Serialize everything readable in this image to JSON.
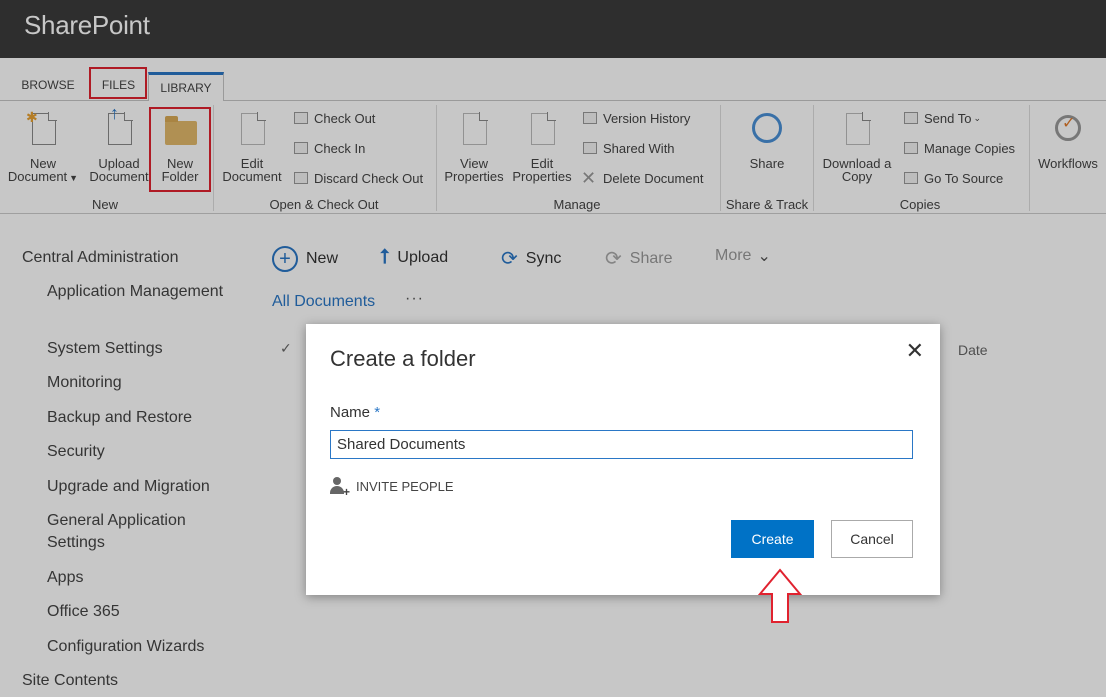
{
  "app": {
    "title": "SharePoint"
  },
  "ribbon_tabs": [
    {
      "label": "BROWSE"
    },
    {
      "label": "FILES"
    },
    {
      "label": "LIBRARY"
    }
  ],
  "ribbon": {
    "new_group": {
      "label": "New",
      "new_document": [
        "New",
        "Document"
      ],
      "upload_document": [
        "Upload",
        "Document"
      ],
      "new_folder": [
        "New",
        "Folder"
      ]
    },
    "open_checkout_group": {
      "label": "Open & Check Out",
      "edit_document": [
        "Edit",
        "Document"
      ],
      "check_out": "Check Out",
      "check_in": "Check In",
      "discard_check_out": "Discard Check Out"
    },
    "manage_group": {
      "label": "Manage",
      "view_properties": [
        "View",
        "Properties"
      ],
      "edit_properties": [
        "Edit",
        "Properties"
      ],
      "version_history": "Version History",
      "shared_with": "Shared With",
      "delete_document": "Delete Document"
    },
    "share_track_group": {
      "label": "Share & Track",
      "share": "Share"
    },
    "copies_group": {
      "label": "Copies",
      "download_copy": [
        "Download a",
        "Copy"
      ],
      "send_to": "Send To",
      "manage_copies": "Manage Copies",
      "go_to_source": "Go To Source"
    },
    "workflows": "Workflows"
  },
  "nav": {
    "items": [
      {
        "label": "Central Administration",
        "level": "top"
      },
      {
        "label": "Application Management",
        "level": "sub"
      },
      {
        "label": "System Settings",
        "level": "sub"
      },
      {
        "label": "Monitoring",
        "level": "sub"
      },
      {
        "label": "Backup and Restore",
        "level": "sub"
      },
      {
        "label": "Security",
        "level": "sub"
      },
      {
        "label": "Upgrade and Migration",
        "level": "sub"
      },
      {
        "label": "General Application Settings",
        "level": "sub"
      },
      {
        "label": "Apps",
        "level": "sub"
      },
      {
        "label": "Office 365",
        "level": "sub"
      },
      {
        "label": "Configuration Wizards",
        "level": "sub"
      },
      {
        "label": "Site Contents",
        "level": "top"
      }
    ]
  },
  "commandbar": {
    "new": "New",
    "upload": "Upload",
    "sync": "Sync",
    "share": "Share",
    "more": "More"
  },
  "view": {
    "all_documents": "All Documents",
    "ellipsis": "···",
    "date_column": "Date"
  },
  "dialog": {
    "title": "Create a folder",
    "name_label": "Name",
    "required_marker": "*",
    "name_value": "Shared Documents",
    "invite_people": "INVITE PEOPLE",
    "create": "Create",
    "cancel": "Cancel",
    "close_symbol": "✕"
  },
  "colors": {
    "topbar": "#3c3c3c",
    "accent": "#0072c6",
    "highlight": "#e0222f"
  }
}
